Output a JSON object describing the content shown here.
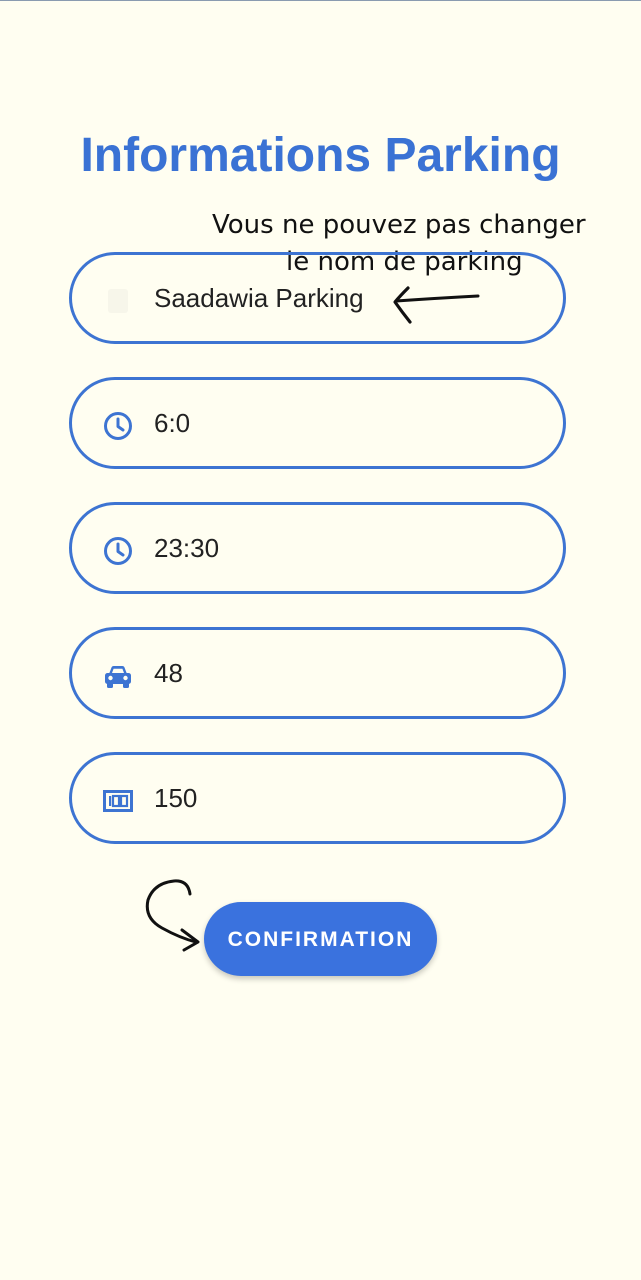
{
  "page": {
    "title": "Informations Parking"
  },
  "annotation": {
    "line1": "Vous ne pouvez pas changer",
    "line2": "le nom de parking"
  },
  "fields": [
    {
      "icon": "parking-icon",
      "value": "Saadawia Parking"
    },
    {
      "icon": "clock-icon",
      "value": "6:0"
    },
    {
      "icon": "clock-icon",
      "value": "23:30"
    },
    {
      "icon": "car-icon",
      "value": "48"
    },
    {
      "icon": "price-tag-icon",
      "value": "150"
    }
  ],
  "actions": {
    "confirm_label": "CONFIRMATION"
  },
  "colors": {
    "background": "#fffef1",
    "accent": "#3a72d4",
    "border": "#3d74d2",
    "button": "#3a72de"
  }
}
